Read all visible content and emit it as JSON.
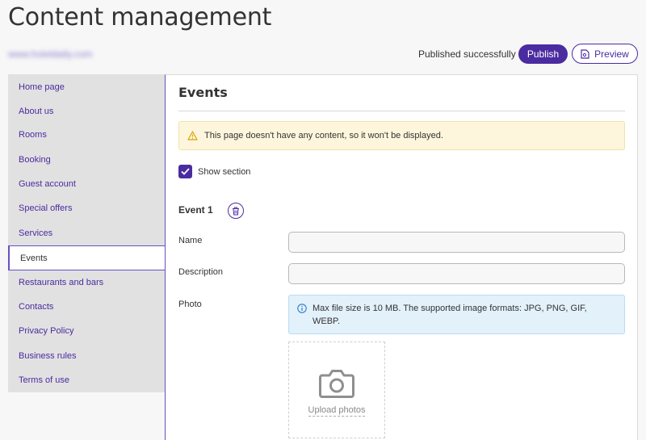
{
  "header": {
    "title": "Content management",
    "hotel_link": "www.hoteldaily.com",
    "status": "Published successfully",
    "publish_label": "Publish",
    "preview_label": "Preview"
  },
  "sidebar": {
    "active_index": 7,
    "items": [
      {
        "label": "Home page"
      },
      {
        "label": "About us"
      },
      {
        "label": "Rooms"
      },
      {
        "label": "Booking"
      },
      {
        "label": "Guest account"
      },
      {
        "label": "Special offers"
      },
      {
        "label": "Services"
      },
      {
        "label": "Events"
      },
      {
        "label": "Restaurants and bars"
      },
      {
        "label": "Contacts"
      },
      {
        "label": "Privacy Policy"
      },
      {
        "label": "Business rules"
      },
      {
        "label": "Terms of use"
      }
    ]
  },
  "main": {
    "title": "Events",
    "warning": "This page doesn't have any content, so it won't be displayed.",
    "show_section_label": "Show section",
    "show_section_checked": true,
    "event": {
      "heading": "Event 1",
      "name_label": "Name",
      "name_value": "",
      "description_label": "Description",
      "description_value": "",
      "photo_label": "Photo",
      "photo_info": "Max file size is 10 MB. The supported image formats: JPG, PNG, GIF, WEBP.",
      "upload_label": "Upload photos"
    }
  },
  "colors": {
    "accent": "#4b2ba0",
    "warning_bg": "#fdf6dc",
    "info_bg": "#e3f1fb"
  }
}
